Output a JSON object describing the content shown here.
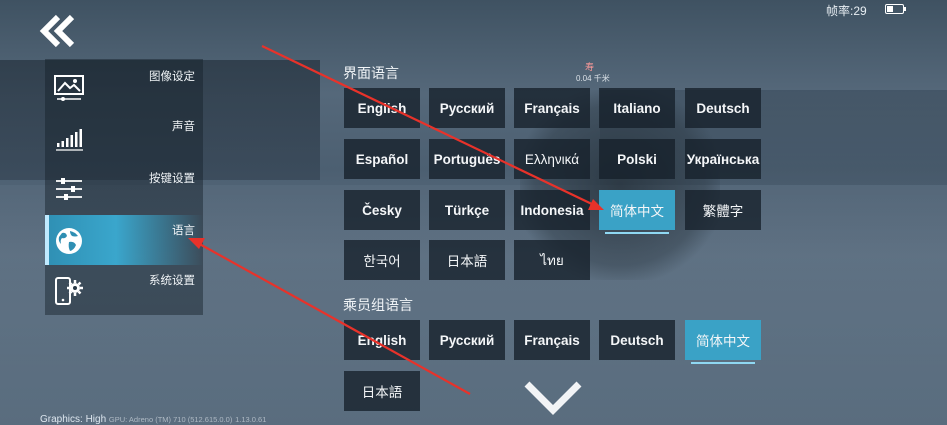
{
  "status": {
    "fps_label": "帧率:29"
  },
  "overlay": {
    "target_name": "寿",
    "target_distance": "0.04 千米"
  },
  "sidebar": {
    "items": [
      {
        "label": "图像设定",
        "icon": "image-icon"
      },
      {
        "label": "声音",
        "icon": "signal-bars-icon"
      },
      {
        "label": "按键设置",
        "icon": "sliders-icon"
      },
      {
        "label": "语言",
        "icon": "globe-icon",
        "active": true
      },
      {
        "label": "系统设置",
        "icon": "phone-gear-icon"
      }
    ]
  },
  "ui_language": {
    "title": "界面语言",
    "options": [
      "English",
      "Русский",
      "Français",
      "Italiano",
      "Deutsch",
      "Español",
      "Português",
      "Ελληνικά",
      "Polski",
      "Українська",
      "Česky",
      "Türkçe",
      "Indonesia",
      "简体中文",
      "繁體字",
      "한국어",
      "日本語",
      "ไทย"
    ],
    "selected": "简体中文"
  },
  "crew_language": {
    "title": "乘员组语言",
    "options": [
      "English",
      "Русский",
      "Français",
      "Deutsch",
      "简体中文",
      "日本語"
    ],
    "selected": "简体中文"
  },
  "footer": {
    "graphics_label": "Graphics: High",
    "gpu_label": "GPU: Adreno (TM) 710 (512.615.0.0)",
    "build_label": "1.13.0.61"
  },
  "colors": {
    "accent": "#3aa2c6",
    "annotation_arrow": "#e8322a"
  }
}
